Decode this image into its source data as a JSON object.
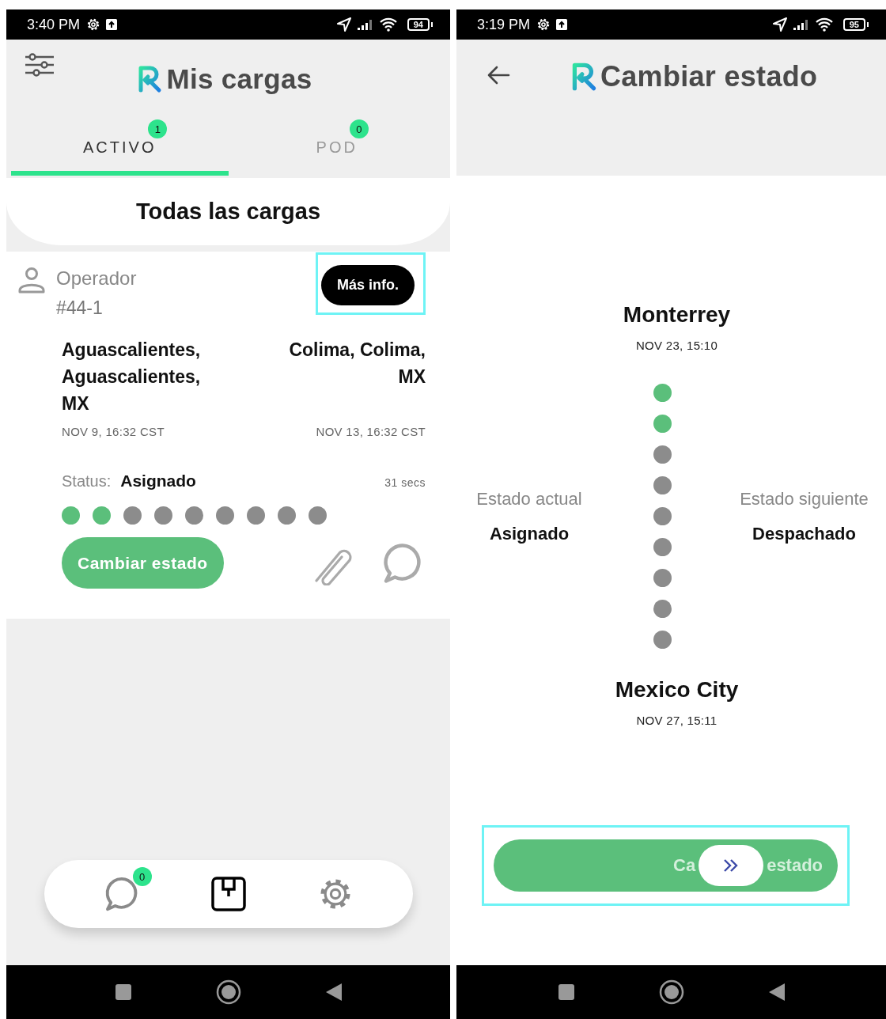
{
  "loads_screen": {
    "status_bar": {
      "time": "3:40 PM",
      "battery": "94"
    },
    "title": "Mis cargas",
    "tabs": [
      {
        "label": "ACTIVO",
        "badge": "1",
        "selected": true
      },
      {
        "label": "POD",
        "badge": "0",
        "selected": false
      }
    ],
    "section_title": "Todas las cargas",
    "load": {
      "operator_label": "Operador",
      "operator_id": "#44-1",
      "more_button": {
        "label": "Más info.",
        "highlighted": true
      },
      "origin": {
        "place": "Aguascalientes, Aguascalientes, MX",
        "date": "NOV 9, 16:32 CST"
      },
      "destination": {
        "place": "Colima, Colima, MX",
        "date": "NOV 13, 16:32 CST"
      },
      "status_label": "Status:",
      "status": "Asignado",
      "elapsed": "31 secs",
      "steps": [
        {
          "done": true
        },
        {
          "done": true
        },
        {
          "done": false
        },
        {
          "done": false
        },
        {
          "done": false
        },
        {
          "done": false
        },
        {
          "done": false
        },
        {
          "done": false
        },
        {
          "done": false
        }
      ],
      "change_button": "Cambiar estado"
    },
    "bottom_nav": [
      {
        "kind": "chat",
        "badge": "0",
        "selected": false
      },
      {
        "kind": "box",
        "selected": true
      },
      {
        "kind": "settings",
        "selected": false
      }
    ]
  },
  "change_status_screen": {
    "status_bar": {
      "time": "3:19 PM",
      "battery": "95"
    },
    "title": "Cambiar estado",
    "origin": {
      "city": "Monterrey",
      "date": "NOV 23, 15:10"
    },
    "destination": {
      "city": "Mexico City",
      "date": "NOV 27, 15:11"
    },
    "current": {
      "label": "Estado actual",
      "value": "Asignado"
    },
    "next": {
      "label": "Estado siguiente",
      "value": "Despachado"
    },
    "steps": [
      {
        "done": true
      },
      {
        "done": true
      },
      {
        "done": false
      },
      {
        "done": false
      },
      {
        "done": false
      },
      {
        "done": false
      },
      {
        "done": false
      },
      {
        "done": false
      },
      {
        "done": false
      }
    ],
    "slider": {
      "label_start": "Ca",
      "label_end": "estado",
      "level": 0.69,
      "highlighted": true
    }
  }
}
